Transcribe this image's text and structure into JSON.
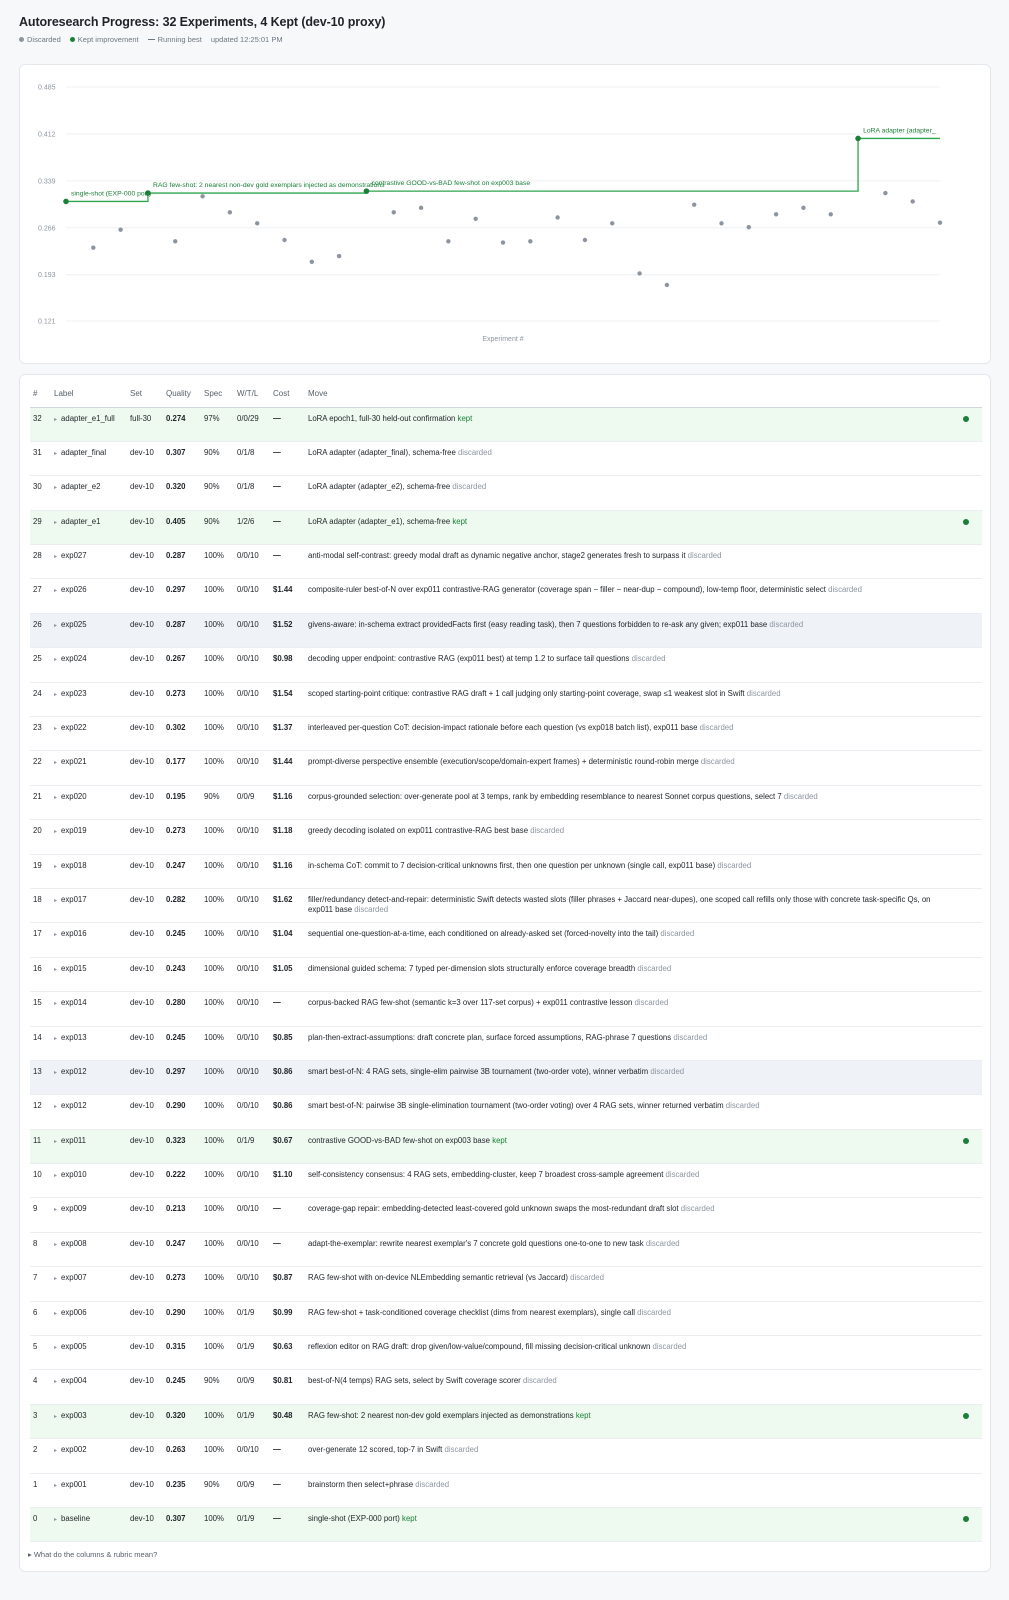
{
  "title": "Autoresearch Progress: 32 Experiments, 4 Kept (dev-10 proxy)",
  "legend": {
    "discarded": "Discarded",
    "kept": "Kept improvement",
    "running": "Running best",
    "updated": "updated 12:25:01 PM"
  },
  "colors": {
    "kept": "#1a7f37",
    "discarded": "#8c959f",
    "running_best": "#2da44e"
  },
  "table": {
    "headers": [
      "#",
      "Label",
      "Set",
      "Quality",
      "Spec",
      "W/T/L",
      "Cost",
      "Move"
    ]
  },
  "footer": "▸ What do the columns & rubric mean?",
  "chart_data": {
    "type": "scatter",
    "xlabel": "Experiment #",
    "ylim": [
      0.121,
      0.485
    ],
    "yticks": [
      "0.485",
      "0.412",
      "0.339",
      "0.266",
      "0.193",
      "0.121"
    ],
    "grid": true,
    "x": [
      0,
      1,
      2,
      3,
      4,
      5,
      6,
      7,
      8,
      9,
      10,
      11,
      12,
      13,
      14,
      15,
      16,
      17,
      18,
      19,
      20,
      21,
      22,
      23,
      24,
      25,
      26,
      27,
      28,
      29,
      30,
      31,
      32
    ],
    "values": [
      0.307,
      0.235,
      0.263,
      0.32,
      0.245,
      0.315,
      0.29,
      0.273,
      0.247,
      0.213,
      0.222,
      0.323,
      0.29,
      0.297,
      0.245,
      0.28,
      0.243,
      0.245,
      0.282,
      0.247,
      0.273,
      0.195,
      0.177,
      0.302,
      0.273,
      0.267,
      0.287,
      0.297,
      0.287,
      0.405,
      0.32,
      0.307,
      0.274
    ],
    "kept_x": [
      0,
      3,
      11,
      29
    ],
    "running_best": {
      "x": [
        0,
        1,
        2,
        3,
        4,
        5,
        6,
        7,
        8,
        9,
        10,
        11,
        12,
        13,
        14,
        15,
        16,
        17,
        18,
        19,
        20,
        21,
        22,
        23,
        24,
        25,
        26,
        27,
        28,
        29,
        30,
        31,
        32
      ],
      "values": [
        0.307,
        0.307,
        0.307,
        0.32,
        0.32,
        0.32,
        0.32,
        0.32,
        0.32,
        0.32,
        0.32,
        0.323,
        0.323,
        0.323,
        0.323,
        0.323,
        0.323,
        0.323,
        0.323,
        0.323,
        0.323,
        0.323,
        0.323,
        0.323,
        0.323,
        0.323,
        0.323,
        0.323,
        0.323,
        0.405,
        0.405,
        0.405,
        0.405
      ]
    },
    "annotations": [
      {
        "x": 0,
        "text": "single-shot (EXP-000 port)"
      },
      {
        "x": 3,
        "text": "RAG few-shot: 2 nearest non-dev gold exemplars injected as demonstrations"
      },
      {
        "x": 11,
        "text": "contrastive GOOD-vs-BAD few-shot on exp003 base"
      },
      {
        "x": 29,
        "text": "LoRA adapter (adapter_"
      }
    ]
  },
  "rows": [
    {
      "n": "32",
      "label": "adapter_e1_full",
      "set": "full-30",
      "quality": "0.274",
      "spec": "97%",
      "wtl": "0/0/29",
      "cost": "—",
      "move": "LoRA epoch1, full-30 held-out confirmation",
      "status": "kept",
      "rowtype": "kept"
    },
    {
      "n": "31",
      "label": "adapter_final",
      "set": "dev-10",
      "quality": "0.307",
      "spec": "90%",
      "wtl": "0/1/8",
      "cost": "—",
      "move": "LoRA adapter (adapter_final), schema-free",
      "status": "discarded",
      "rowtype": ""
    },
    {
      "n": "30",
      "label": "adapter_e2",
      "set": "dev-10",
      "quality": "0.320",
      "spec": "90%",
      "wtl": "0/1/8",
      "cost": "—",
      "move": "LoRA adapter (adapter_e2), schema-free",
      "status": "discarded",
      "rowtype": ""
    },
    {
      "n": "29",
      "label": "adapter_e1",
      "set": "dev-10",
      "quality": "0.405",
      "spec": "90%",
      "wtl": "1/2/6",
      "cost": "—",
      "move": "LoRA adapter (adapter_e1), schema-free",
      "status": "kept",
      "rowtype": "kept"
    },
    {
      "n": "28",
      "label": "exp027",
      "set": "dev-10",
      "quality": "0.287",
      "spec": "100%",
      "wtl": "0/0/10",
      "cost": "—",
      "move": "anti-modal self-contrast: greedy modal draft as dynamic negative anchor, stage2 generates fresh to surpass it",
      "status": "discarded",
      "rowtype": ""
    },
    {
      "n": "27",
      "label": "exp026",
      "set": "dev-10",
      "quality": "0.297",
      "spec": "100%",
      "wtl": "0/0/10",
      "cost": "$1.44",
      "move": "composite-ruler best-of-N over exp011 contrastive-RAG generator (coverage span − filler − near-dup − compound), low-temp floor, deterministic select",
      "status": "discarded",
      "rowtype": ""
    },
    {
      "n": "26",
      "label": "exp025",
      "set": "dev-10",
      "quality": "0.287",
      "spec": "100%",
      "wtl": "0/0/10",
      "cost": "$1.52",
      "move": "givens-aware: in-schema extract providedFacts first (easy reading task), then 7 questions forbidden to re-ask any given; exp011 base",
      "status": "discarded",
      "rowtype": "hl"
    },
    {
      "n": "25",
      "label": "exp024",
      "set": "dev-10",
      "quality": "0.267",
      "spec": "100%",
      "wtl": "0/0/10",
      "cost": "$0.98",
      "move": "decoding upper endpoint: contrastive RAG (exp011 best) at temp 1.2 to surface tail questions",
      "status": "discarded",
      "rowtype": ""
    },
    {
      "n": "24",
      "label": "exp023",
      "set": "dev-10",
      "quality": "0.273",
      "spec": "100%",
      "wtl": "0/0/10",
      "cost": "$1.54",
      "move": "scoped starting-point critique: contrastive RAG draft + 1 call judging only starting-point coverage, swap ≤1 weakest slot in Swift",
      "status": "discarded",
      "rowtype": ""
    },
    {
      "n": "23",
      "label": "exp022",
      "set": "dev-10",
      "quality": "0.302",
      "spec": "100%",
      "wtl": "0/0/10",
      "cost": "$1.37",
      "move": "interleaved per-question CoT: decision-impact rationale before each question (vs exp018 batch list), exp011 base",
      "status": "discarded",
      "rowtype": ""
    },
    {
      "n": "22",
      "label": "exp021",
      "set": "dev-10",
      "quality": "0.177",
      "spec": "100%",
      "wtl": "0/0/10",
      "cost": "$1.44",
      "move": "prompt-diverse perspective ensemble (execution/scope/domain-expert frames) + deterministic round-robin merge",
      "status": "discarded",
      "rowtype": ""
    },
    {
      "n": "21",
      "label": "exp020",
      "set": "dev-10",
      "quality": "0.195",
      "spec": "90%",
      "wtl": "0/0/9",
      "cost": "$1.16",
      "move": "corpus-grounded selection: over-generate pool at 3 temps, rank by embedding resemblance to nearest Sonnet corpus questions, select 7",
      "status": "discarded",
      "rowtype": ""
    },
    {
      "n": "20",
      "label": "exp019",
      "set": "dev-10",
      "quality": "0.273",
      "spec": "100%",
      "wtl": "0/0/10",
      "cost": "$1.18",
      "move": "greedy decoding isolated on exp011 contrastive-RAG best base",
      "status": "discarded",
      "rowtype": ""
    },
    {
      "n": "19",
      "label": "exp018",
      "set": "dev-10",
      "quality": "0.247",
      "spec": "100%",
      "wtl": "0/0/10",
      "cost": "$1.16",
      "move": "in-schema CoT: commit to 7 decision-critical unknowns first, then one question per unknown (single call, exp011 base)",
      "status": "discarded",
      "rowtype": ""
    },
    {
      "n": "18",
      "label": "exp017",
      "set": "dev-10",
      "quality": "0.282",
      "spec": "100%",
      "wtl": "0/0/10",
      "cost": "$1.62",
      "move": "filler/redundancy detect-and-repair: deterministic Swift detects wasted slots (filler phrases + Jaccard near-dupes), one scoped call refills only those with concrete task-specific Qs, on exp011 base",
      "status": "discarded",
      "rowtype": ""
    },
    {
      "n": "17",
      "label": "exp016",
      "set": "dev-10",
      "quality": "0.245",
      "spec": "100%",
      "wtl": "0/0/10",
      "cost": "$1.04",
      "move": "sequential one-question-at-a-time, each conditioned on already-asked set (forced-novelty into the tail)",
      "status": "discarded",
      "rowtype": ""
    },
    {
      "n": "16",
      "label": "exp015",
      "set": "dev-10",
      "quality": "0.243",
      "spec": "100%",
      "wtl": "0/0/10",
      "cost": "$1.05",
      "move": "dimensional guided schema: 7 typed per-dimension slots structurally enforce coverage breadth",
      "status": "discarded",
      "rowtype": ""
    },
    {
      "n": "15",
      "label": "exp014",
      "set": "dev-10",
      "quality": "0.280",
      "spec": "100%",
      "wtl": "0/0/10",
      "cost": "—",
      "move": "corpus-backed RAG few-shot (semantic k=3 over 117-set corpus) + exp011 contrastive lesson",
      "status": "discarded",
      "rowtype": ""
    },
    {
      "n": "14",
      "label": "exp013",
      "set": "dev-10",
      "quality": "0.245",
      "spec": "100%",
      "wtl": "0/0/10",
      "cost": "$0.85",
      "move": "plan-then-extract-assumptions: draft concrete plan, surface forced assumptions, RAG-phrase 7 questions",
      "status": "discarded",
      "rowtype": ""
    },
    {
      "n": "13",
      "label": "exp012",
      "set": "dev-10",
      "quality": "0.297",
      "spec": "100%",
      "wtl": "0/0/10",
      "cost": "$0.86",
      "move": "smart best-of-N: 4 RAG sets, single-elim pairwise 3B tournament (two-order vote), winner verbatim",
      "status": "discarded",
      "rowtype": "hl"
    },
    {
      "n": "12",
      "label": "exp012",
      "set": "dev-10",
      "quality": "0.290",
      "spec": "100%",
      "wtl": "0/0/10",
      "cost": "$0.86",
      "move": "smart best-of-N: pairwise 3B single-elimination tournament (two-order voting) over 4 RAG sets, winner returned verbatim",
      "status": "discarded",
      "rowtype": ""
    },
    {
      "n": "11",
      "label": "exp011",
      "set": "dev-10",
      "quality": "0.323",
      "spec": "100%",
      "wtl": "0/1/9",
      "cost": "$0.67",
      "move": "contrastive GOOD-vs-BAD few-shot on exp003 base",
      "status": "kept",
      "rowtype": "kept"
    },
    {
      "n": "10",
      "label": "exp010",
      "set": "dev-10",
      "quality": "0.222",
      "spec": "100%",
      "wtl": "0/0/10",
      "cost": "$1.10",
      "move": "self-consistency consensus: 4 RAG sets, embedding-cluster, keep 7 broadest cross-sample agreement",
      "status": "discarded",
      "rowtype": ""
    },
    {
      "n": "9",
      "label": "exp009",
      "set": "dev-10",
      "quality": "0.213",
      "spec": "100%",
      "wtl": "0/0/10",
      "cost": "—",
      "move": "coverage-gap repair: embedding-detected least-covered gold unknown swaps the most-redundant draft slot",
      "status": "discarded",
      "rowtype": ""
    },
    {
      "n": "8",
      "label": "exp008",
      "set": "dev-10",
      "quality": "0.247",
      "spec": "100%",
      "wtl": "0/0/10",
      "cost": "—",
      "move": "adapt-the-exemplar: rewrite nearest exemplar's 7 concrete gold questions one-to-one to new task",
      "status": "discarded",
      "rowtype": ""
    },
    {
      "n": "7",
      "label": "exp007",
      "set": "dev-10",
      "quality": "0.273",
      "spec": "100%",
      "wtl": "0/0/10",
      "cost": "$0.87",
      "move": "RAG few-shot with on-device NLEmbedding semantic retrieval (vs Jaccard)",
      "status": "discarded",
      "rowtype": ""
    },
    {
      "n": "6",
      "label": "exp006",
      "set": "dev-10",
      "quality": "0.290",
      "spec": "100%",
      "wtl": "0/1/9",
      "cost": "$0.99",
      "move": "RAG few-shot + task-conditioned coverage checklist (dims from nearest exemplars), single call",
      "status": "discarded",
      "rowtype": ""
    },
    {
      "n": "5",
      "label": "exp005",
      "set": "dev-10",
      "quality": "0.315",
      "spec": "100%",
      "wtl": "0/1/9",
      "cost": "$0.63",
      "move": "reflexion editor on RAG draft: drop given/low-value/compound, fill missing decision-critical unknown",
      "status": "discarded",
      "rowtype": ""
    },
    {
      "n": "4",
      "label": "exp004",
      "set": "dev-10",
      "quality": "0.245",
      "spec": "90%",
      "wtl": "0/0/9",
      "cost": "$0.81",
      "move": "best-of-N(4 temps) RAG sets, select by Swift coverage scorer",
      "status": "discarded",
      "rowtype": ""
    },
    {
      "n": "3",
      "label": "exp003",
      "set": "dev-10",
      "quality": "0.320",
      "spec": "100%",
      "wtl": "0/1/9",
      "cost": "$0.48",
      "move": "RAG few-shot: 2 nearest non-dev gold exemplars injected as demonstrations",
      "status": "kept",
      "rowtype": "kept"
    },
    {
      "n": "2",
      "label": "exp002",
      "set": "dev-10",
      "quality": "0.263",
      "spec": "100%",
      "wtl": "0/0/10",
      "cost": "—",
      "move": "over-generate 12 scored, top-7 in Swift",
      "status": "discarded",
      "rowtype": ""
    },
    {
      "n": "1",
      "label": "exp001",
      "set": "dev-10",
      "quality": "0.235",
      "spec": "90%",
      "wtl": "0/0/9",
      "cost": "—",
      "move": "brainstorm then select+phrase",
      "status": "discarded",
      "rowtype": ""
    },
    {
      "n": "0",
      "label": "baseline",
      "set": "dev-10",
      "quality": "0.307",
      "spec": "100%",
      "wtl": "0/1/9",
      "cost": "—",
      "move": "single-shot (EXP-000 port)",
      "status": "kept",
      "rowtype": "kept"
    }
  ]
}
